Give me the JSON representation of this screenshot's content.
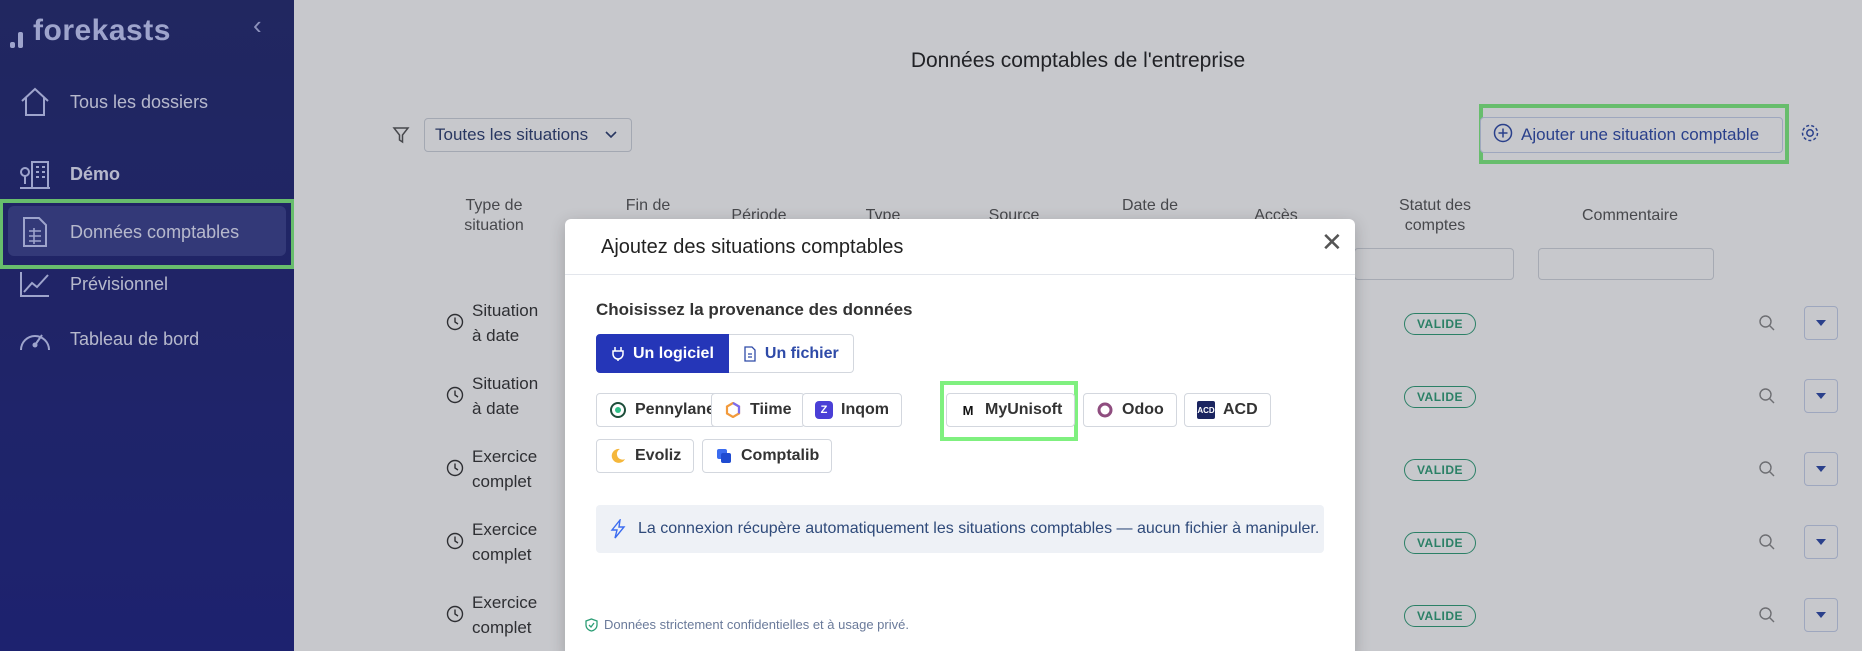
{
  "app": {
    "logo_text": "forekasts"
  },
  "sidebar": {
    "items": [
      {
        "label": "Tous les dossiers",
        "icon": "home-icon"
      },
      {
        "label": "Démo",
        "icon": "company-icon"
      },
      {
        "label": "Données comptables",
        "icon": "ledger-icon"
      },
      {
        "label": "Prévisionnel",
        "icon": "chart-line-icon"
      },
      {
        "label": "Tableau de bord",
        "icon": "gauge-icon"
      }
    ]
  },
  "main": {
    "title": "Données comptables de l'entreprise",
    "filter_select": "Toutes les situations",
    "add_button": "Ajouter une situation comptable",
    "columns": [
      "Type de situation",
      "Fin de",
      "Période",
      "Type",
      "Source",
      "Date de",
      "Accès",
      "Statut des comptes",
      "Commentaire"
    ],
    "rows": [
      {
        "type_line1": "Situation",
        "type_line2": "à date",
        "status": "VALIDE"
      },
      {
        "type_line1": "Situation",
        "type_line2": "à date",
        "status": "VALIDE"
      },
      {
        "type_line1": "Exercice",
        "type_line2": "complet",
        "status": "VALIDE"
      },
      {
        "type_line1": "Exercice",
        "type_line2": "complet",
        "status": "VALIDE"
      },
      {
        "type_line1": "Exercice",
        "type_line2": "complet",
        "status": "VALIDE"
      }
    ]
  },
  "modal": {
    "title": "Ajoutez des situations comptables",
    "close": "✕",
    "source_label": "Choisissez la provenance des données",
    "source_options": [
      "Un logiciel",
      "Un fichier"
    ],
    "software": [
      "Pennylane",
      "Tiime",
      "Inqom",
      "MyUnisoft",
      "Odoo",
      "ACD",
      "Evoliz",
      "Comptalib"
    ],
    "acd_logo_text": "ACD",
    "info": "La connexion récupère automatiquement les situations comptables — aucun fichier à manipuler.",
    "footer": "Données strictement confidentielles et à usage privé."
  },
  "colors": {
    "sidebar": "#1f2478",
    "accent": "#2536b8",
    "highlight": "#7ff07f",
    "valid": "#2f9f77"
  }
}
